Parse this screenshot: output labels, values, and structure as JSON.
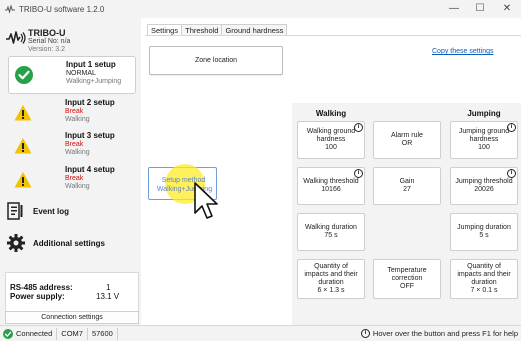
{
  "window": {
    "title": "TRIBO-U software 1.2.0",
    "minimize_glyph": "—",
    "maximize_glyph": "☐",
    "close_glyph": "✕"
  },
  "device": {
    "name": "TRIBO-U",
    "serial": "Serial No: n/a",
    "version": "Version: 3.2"
  },
  "inputs": [
    {
      "label": "Input 1 setup",
      "status": "NORMAL",
      "mode": "Walking+Jumping",
      "state": "ok",
      "icon": "check-circle-icon"
    },
    {
      "label": "Input 2 setup",
      "status": "Break",
      "mode": "Walking",
      "state": "warn",
      "icon": "warning-icon"
    },
    {
      "label": "Input 3 setup",
      "status": "Break",
      "mode": "Walking",
      "state": "warn",
      "icon": "warning-icon"
    },
    {
      "label": "Input 4 setup",
      "status": "Break",
      "mode": "Walking",
      "state": "warn",
      "icon": "warning-icon"
    }
  ],
  "nav": {
    "event_log": "Event log",
    "additional_settings": "Additional settings"
  },
  "bus": {
    "rs485_label": "RS-485 address:",
    "rs485_value": "1",
    "power_label": "Power supply:",
    "power_value": "13.1 V"
  },
  "connection_settings": "Connection settings",
  "tabs": [
    "Settings",
    "Threshold",
    "Ground hardness"
  ],
  "settings": {
    "zone_location": "Zone location",
    "copy_link": "Copy these settings",
    "setup_method_line1": "Setup method",
    "setup_method_line2": "Walking+Jumping",
    "walking_header": "Walking",
    "jumping_header": "Jumping",
    "walking": {
      "ground_hardness": [
        "Walking ground",
        "hardness",
        "100"
      ],
      "threshold": [
        "Walking threshold",
        "10166"
      ],
      "duration": [
        "Walking duration",
        "75 s"
      ],
      "quantity": [
        "Quantity of",
        "impacts and their",
        "duration",
        "6 × 1.3 s"
      ]
    },
    "middle": {
      "alarm_rule": [
        "Alarm rule",
        "OR"
      ],
      "gain": [
        "Gain",
        "27"
      ],
      "temperature": [
        "Temperature",
        "correction",
        "OFF"
      ]
    },
    "jumping": {
      "ground_hardness": [
        "Jumping ground",
        "hardness",
        "100"
      ],
      "threshold": [
        "Jumping threshold",
        "20026"
      ],
      "duration": [
        "Jumping duration",
        "5 s"
      ],
      "quantity": [
        "Quantity of",
        "impacts and their",
        "duration",
        "7 × 0.1 s"
      ]
    }
  },
  "status_bar": {
    "connected": "Connected",
    "port": "COM7",
    "baud": "57600",
    "hint": "Hover over the button and press F1 for help"
  },
  "colors": {
    "ok_green": "#27a048",
    "warn_yellow": "#f3c200",
    "break_red": "#d01010",
    "link_blue": "#0d5bbd"
  }
}
